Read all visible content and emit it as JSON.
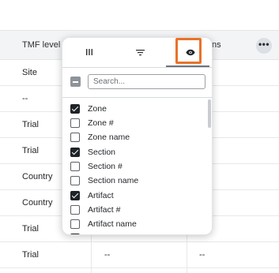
{
  "grid": {
    "header": {
      "col_tmf": "TMF level",
      "col_ns": "ns",
      "more_label": "•••"
    },
    "rows": [
      {
        "c1": "Site",
        "c2": "",
        "c3": ""
      },
      {
        "c1": "--",
        "c2": "",
        "c3": ""
      },
      {
        "c1": "Trial",
        "c2": "",
        "c3": ""
      },
      {
        "c1": "Trial",
        "c2": "",
        "c3": ""
      },
      {
        "c1": "Country",
        "c2": "",
        "c3": ""
      },
      {
        "c1": "Country",
        "c2": "",
        "c3": ""
      },
      {
        "c1": "Trial",
        "c2": "",
        "c3": ""
      },
      {
        "c1": "Trial",
        "c2": "--",
        "c3": "--"
      }
    ]
  },
  "panel": {
    "tabs": [
      "columns-icon",
      "filter-icon",
      "eye-icon"
    ],
    "active_tab": "visibility",
    "search": {
      "placeholder": "Search...",
      "value": ""
    },
    "items": [
      {
        "label": "Zone",
        "checked": true
      },
      {
        "label": "Zone #",
        "checked": false
      },
      {
        "label": "Zone name",
        "checked": false
      },
      {
        "label": "Section",
        "checked": true
      },
      {
        "label": "Section #",
        "checked": false
      },
      {
        "label": "Section name",
        "checked": false
      },
      {
        "label": "Artifact",
        "checked": true
      },
      {
        "label": "Artifact #",
        "checked": false
      },
      {
        "label": "Artifact name",
        "checked": false
      },
      {
        "label": "",
        "checked": true
      }
    ]
  },
  "colors": {
    "highlight": "#e8732a",
    "header_bg": "#f3f4f6",
    "checkbox_checked": "#1f2328"
  }
}
